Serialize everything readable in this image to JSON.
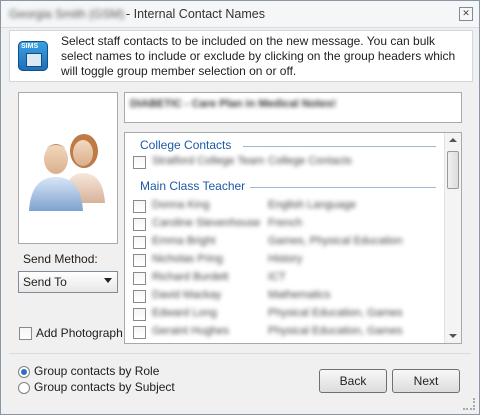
{
  "window": {
    "title_prefix": "Georgia Smith (GSM)",
    "title": "- Internal Contact Names",
    "close_glyph": "✕"
  },
  "info": {
    "icon": "sims-app-icon",
    "icon_logo": "SIMS",
    "text": "Select staff contacts to be included on the new message. You can bulk select names to include or exclude by clicking on the group headers which will toggle group member selection on or off."
  },
  "message_subject": "DIABETIC - Care Plan in Medical Notes!",
  "contacts": {
    "groups": [
      {
        "name": "College Contacts",
        "members": [
          {
            "name": "Stratford College Team",
            "subject": "College Contacts"
          }
        ]
      },
      {
        "name": "Main Class Teacher",
        "members": [
          {
            "name": "Donna King",
            "subject": "English Language"
          },
          {
            "name": "Caroline Stevenhouse",
            "subject": "French"
          },
          {
            "name": "Emma Bright",
            "subject": "Games, Physical Education"
          },
          {
            "name": "Nicholas Pring",
            "subject": "History"
          },
          {
            "name": "Richard Burdett",
            "subject": "ICT"
          },
          {
            "name": "David Mackay",
            "subject": "Mathematics"
          },
          {
            "name": "Edward Long",
            "subject": "Physical Education, Games"
          },
          {
            "name": "Geraint Hughes",
            "subject": "Physical Education, Games"
          }
        ]
      }
    ]
  },
  "send_method": {
    "label": "Send Method:",
    "selected": "Send To"
  },
  "add_photograph": {
    "label": "Add Photograph",
    "checked": false
  },
  "grouping": {
    "options": [
      {
        "label": "Group contacts by Role",
        "selected": true
      },
      {
        "label": "Group contacts by Subject",
        "selected": false
      }
    ]
  },
  "buttons": {
    "back": "Back",
    "next": "Next"
  },
  "colors": {
    "accent": "#1d5aa6",
    "window_bg": "#f0f0f0"
  }
}
